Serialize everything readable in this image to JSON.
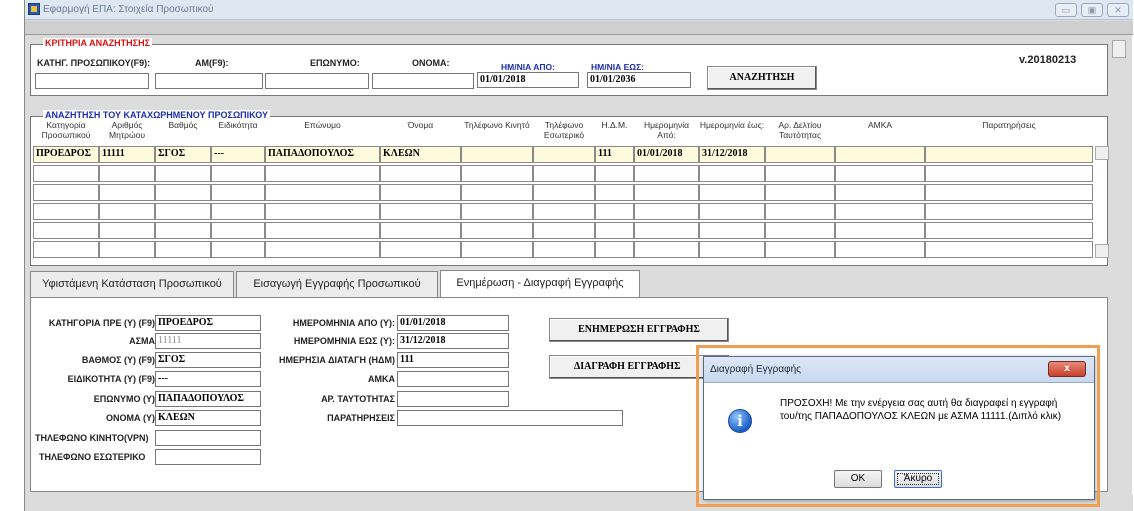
{
  "window": {
    "title": "Εφαρμογή ΕΠΑ: Στοιχεία Προσωπικού",
    "controls": [
      "▭",
      "▣",
      "✕"
    ]
  },
  "criteria": {
    "group_label": "ΚΡΙΤΗΡΙΑ ΑΝΑΖΗΤΗΣΗΣ",
    "version": "v.20180213",
    "labels": {
      "category": "ΚΑΤΗΓ. ΠΡΟΣΩΠΙΚΟΥ(F9):",
      "am": "ΑΜ(F9):",
      "surname": "ΕΠΩΝΥΜΟ:",
      "name": "ΟΝΟΜΑ:",
      "date_from": "ΗΜ/ΝΙΑ ΑΠΟ:",
      "date_to": "ΗΜ/ΝΙΑ ΕΩΣ:"
    },
    "values": {
      "category": "",
      "am": "",
      "surname": "",
      "name": "",
      "date_from": "01/01/2018",
      "date_to": "01/01/2036"
    },
    "search_button": "ΑΝΑΖΗΤΗΣΗ"
  },
  "results": {
    "group_label": "ΑΝΑΖΗΤΗΣΗ ΤΟΥ ΚΑΤΑΧΩΡΗΜΕΝΟΥ ΠΡΟΣΩΠΙΚΟΥ",
    "columns": [
      "Κατηγορία Προσωπικού",
      "Αριθμός Μητρώου",
      "Βαθμός",
      "Ειδικότητα",
      "Επώνυμο",
      "Όνομα",
      "Τηλέφωνο Κινητό",
      "Τηλέφωνο Εσωτερικό",
      "Η.Δ.Μ.",
      "Ημερομηνία Από:",
      "Ημερομηνία έως:",
      "Αρ. Δελτίου Ταυτότητας",
      "ΑΜΚΑ",
      "Παρατηρήσεις"
    ],
    "rows": [
      [
        "ΠΡΟΕΔΡΟΣ",
        "11111",
        "ΣΓΟΣ",
        "---",
        "ΠΑΠΑΔΟΠΟΥΛΟΣ",
        "ΚΛΕΩΝ",
        "",
        "",
        "111",
        "01/01/2018",
        "31/12/2018",
        "",
        "",
        ""
      ],
      [
        "",
        "",
        "",
        "",
        "",
        "",
        "",
        "",
        "",
        "",
        "",
        "",
        "",
        ""
      ],
      [
        "",
        "",
        "",
        "",
        "",
        "",
        "",
        "",
        "",
        "",
        "",
        "",
        "",
        ""
      ],
      [
        "",
        "",
        "",
        "",
        "",
        "",
        "",
        "",
        "",
        "",
        "",
        "",
        "",
        ""
      ],
      [
        "",
        "",
        "",
        "",
        "",
        "",
        "",
        "",
        "",
        "",
        "",
        "",
        "",
        ""
      ],
      [
        "",
        "",
        "",
        "",
        "",
        "",
        "",
        "",
        "",
        "",
        "",
        "",
        "",
        ""
      ]
    ]
  },
  "tabs": [
    {
      "label": "Υφιστάμενη Κατάσταση Προσωπικού"
    },
    {
      "label": "Εισαγωγή Εγγραφής Προσωπικού"
    },
    {
      "label": "Ενημέρωση - Διαγραφή Εγγραφής"
    }
  ],
  "form": {
    "category_label": "ΚΑΤΗΓΟΡΙΑ ΠΡΕ (Υ) (F9)",
    "category_value": "ΠΡΟΕΔΡΟΣ",
    "asma_label": "ΑΣΜΑ",
    "asma_value": "11111",
    "rank_label": "ΒΑΘΜΟΣ (Υ) (F9)",
    "rank_value": "ΣΓΟΣ",
    "specialty_label": "ΕΙΔΙΚΟΤΗΤΑ (Υ) (F9)",
    "specialty_value": "---",
    "surname_label": "ΕΠΩΝΥΜΟ (Υ)",
    "surname_value": "ΠΑΠΑΔΟΠΟΥΛΟΣ",
    "name_label": "ΟΝΟΜΑ (Υ)",
    "name_value": "ΚΛΕΩΝ",
    "mobile_label": "ΤΗΛΕΦΩΝΟ ΚΙΝΗΤΟ(VPN)",
    "mobile_value": "",
    "internal_label": "ΤΗΛΕΦΩΝΟ ΕΣΩΤΕΡΙΚΟ",
    "internal_value": "",
    "date_from_label": "ΗΜΕΡΟΜΗΝΙΑ ΑΠΟ (Υ):",
    "date_from_value": "01/01/2018",
    "date_to_label": "ΗΜΕΡΟΜΗΝΙΑ ΕΩΣ (Υ):",
    "date_to_value": "31/12/2018",
    "order_label": "ΗΜΕΡΗΣΙΑ ΔΙΑΤΑΓΗ (ΗΔΜ)",
    "order_value": "111",
    "amka_label": "ΑΜΚΑ",
    "amka_value": "",
    "id_label": "ΑΡ. ΤΑΥΤΟΤΗΤΑΣ",
    "id_value": "",
    "notes_label": "ΠΑΡΑΤΗΡΗΣΕΙΣ",
    "notes_value": "",
    "update_button": "ΕΝΗΜΕΡΩΣΗ ΕΓΓΡΑΦΗΣ",
    "delete_button": "ΔΙΑΓΡΑΦΗ ΕΓΓΡΑΦΗΣ"
  },
  "dialog": {
    "title": "Διαγραφή Εγγραφής",
    "message": "ΠΡΟΣΟΧΗ! Με την ενέργεια σας αυτή θα διαγραφεί η εγγραφή του/της ΠΑΠΑΔΟΠΟΥΛΟΣ ΚΛΕΩΝ με ΑΣΜΑ 11111.(Διπλό κλικ)",
    "ok": "OK",
    "cancel": "Άκυρο",
    "close": "x",
    "icon_glyph": "i"
  },
  "colors": {
    "criteria_label": "#e01010",
    "results_label": "#1a2fb0",
    "selected_row": "#fdfbdc",
    "highlight": "#f0a050"
  }
}
